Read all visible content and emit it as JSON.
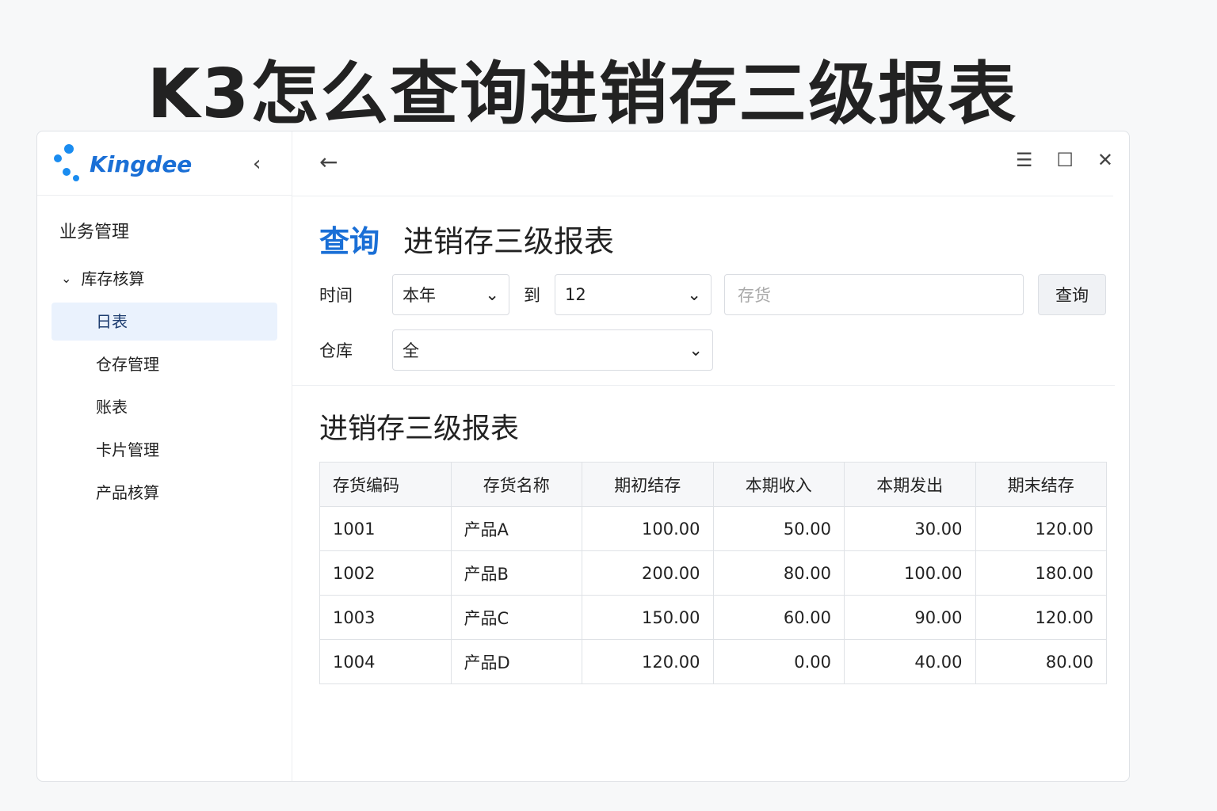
{
  "headline": "K3怎么查询进销存三级报表",
  "brand": {
    "name": "Kingdee",
    "color": "#1a6fd6"
  },
  "sidebar": {
    "group": "业务管理",
    "section": "库存核算",
    "items": [
      {
        "label": "日表",
        "active": true
      },
      {
        "label": "仓存管理"
      },
      {
        "label": "账表"
      },
      {
        "label": "卡片管理"
      },
      {
        "label": "产品核算"
      }
    ]
  },
  "page": {
    "title_prefix": "查询",
    "title": "进销存三级报表"
  },
  "filters": {
    "time_label": "时间",
    "time_from": "本年",
    "to_label": "到",
    "time_to": "12",
    "item_placeholder": "存货",
    "query_button": "查询",
    "warehouse_label": "仓库",
    "warehouse_value": "全"
  },
  "report": {
    "title": "进销存三级报表",
    "columns": [
      "存货编码",
      "存货名称",
      "期初结存",
      "本期收入",
      "本期发出",
      "期末结存"
    ],
    "rows": [
      [
        "1001",
        "产品A",
        "100.00",
        "50.00",
        "30.00",
        "120.00"
      ],
      [
        "1002",
        "产品B",
        "200.00",
        "80.00",
        "100.00",
        "180.00"
      ],
      [
        "1003",
        "产品C",
        "150.00",
        "60.00",
        "90.00",
        "120.00"
      ],
      [
        "1004",
        "产品D",
        "120.00",
        "0.00",
        "40.00",
        "80.00"
      ]
    ]
  }
}
